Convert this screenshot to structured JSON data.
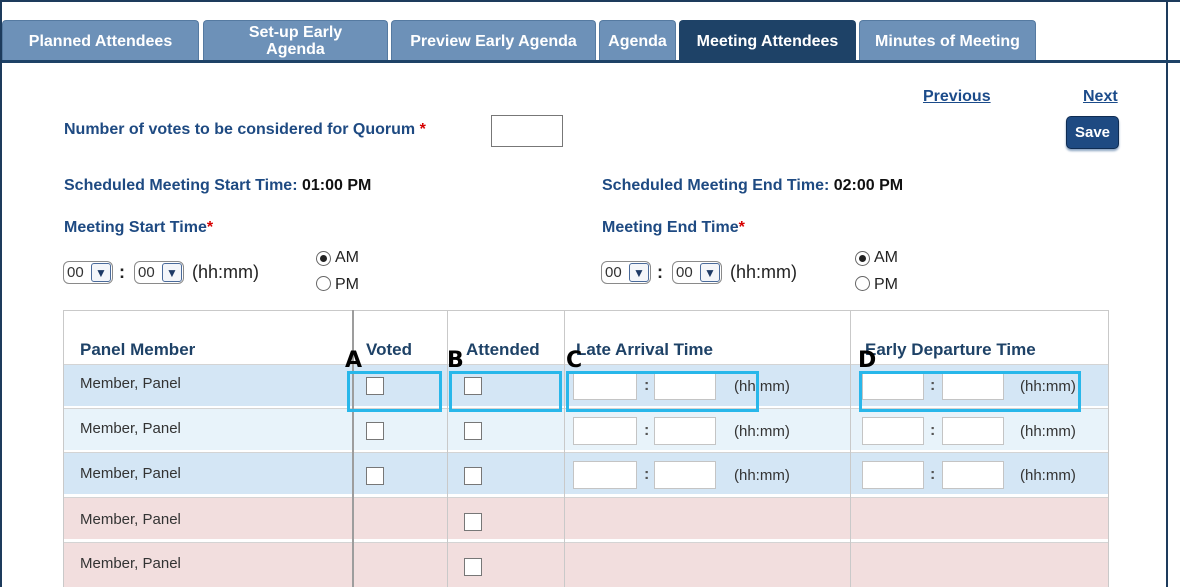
{
  "tabs": [
    {
      "label": "Planned Attendees"
    },
    {
      "label": "Set-up Early Agenda"
    },
    {
      "label": "Preview Early Agenda"
    },
    {
      "label": "Agenda"
    },
    {
      "label": "Meeting Attendees"
    },
    {
      "label": "Minutes of Meeting"
    }
  ],
  "nav": {
    "previous": "Previous",
    "next": "Next",
    "save": "Save"
  },
  "quorum": {
    "label": "Number of votes to be considered for Quorum",
    "required": "*",
    "value": ""
  },
  "schedule": {
    "start_label": "Scheduled Meeting Start Time:",
    "start_value": "01:00 PM",
    "end_label": "Scheduled Meeting End Time:",
    "end_value": "02:00 PM"
  },
  "meeting_start": {
    "label": "Meeting Start Time",
    "required": "*",
    "hour": "00",
    "minute": "00",
    "sep": ":",
    "format": "(hh:mm)",
    "am": "AM",
    "pm": "PM",
    "selected": "AM"
  },
  "meeting_end": {
    "label": "Meeting End Time",
    "required": "*",
    "hour": "00",
    "minute": "00",
    "sep": ":",
    "format": "(hh:mm)",
    "am": "AM",
    "pm": "PM",
    "selected": "AM"
  },
  "table": {
    "headers": [
      "Panel Member",
      "Voted",
      "Attended",
      "Late Arrival Time",
      "Early Departure Time"
    ],
    "time_format": "(hh:mm)",
    "time_sep": ":",
    "rows": [
      {
        "name": "Member, Panel"
      },
      {
        "name": "Member, Panel"
      },
      {
        "name": "Member, Panel"
      },
      {
        "name": "Member, Panel"
      },
      {
        "name": "Member, Panel"
      }
    ]
  },
  "annotations": {
    "a": "A",
    "b": "B",
    "c": "C",
    "d": "D"
  },
  "colors": {
    "tab": "#6d91b8",
    "tab_active": "#1e4267",
    "highlight": "#28b7ea",
    "row_blue": "#d4e6f5",
    "row_pink": "#f2dede"
  },
  "icons": {
    "dropdown": "chevron-down-icon"
  }
}
